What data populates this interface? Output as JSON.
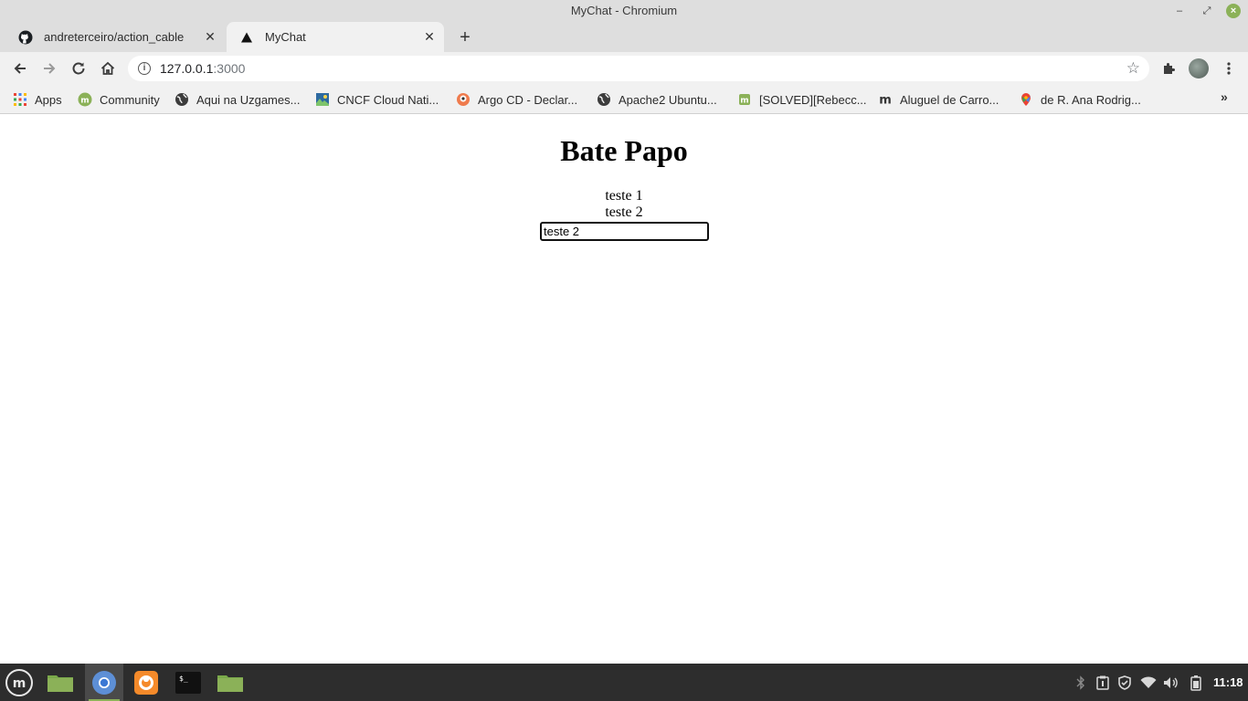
{
  "window": {
    "title": "MyChat - Chromium"
  },
  "tabs": [
    {
      "label": "andreterceiro/action_cable",
      "icon": "github-icon"
    },
    {
      "label": "MyChat",
      "icon": "triangle-icon"
    }
  ],
  "toolbar": {
    "url_host": "127.0.0.1",
    "url_port": ":3000"
  },
  "bookmarks": [
    {
      "label": "Apps",
      "icon": "apps-grid-icon"
    },
    {
      "label": "Community",
      "icon": "linux-mint-icon"
    },
    {
      "label": "Aqui na Uzgames...",
      "icon": "globe-icon"
    },
    {
      "label": "CNCF Cloud Nati...",
      "icon": "cncf-icon"
    },
    {
      "label": "Argo CD - Declar...",
      "icon": "argo-icon"
    },
    {
      "label": "Apache2 Ubuntu...",
      "icon": "globe-icon"
    },
    {
      "label": "[SOLVED][Rebecc...",
      "icon": "linux-mint-icon"
    },
    {
      "label": "Aluguel de Carro...",
      "icon": "m-icon"
    },
    {
      "label": "de R. Ana Rodrig...",
      "icon": "maps-pin-icon"
    }
  ],
  "page": {
    "title": "Bate Papo",
    "messages": [
      "teste 1",
      "teste 2"
    ],
    "input_value": "teste 2"
  },
  "taskbar": {
    "clock": "11:18"
  },
  "colors": {
    "mint_green": "#8bb158",
    "taskbar_bg": "#2d2d2d",
    "chrome_bg": "#dedede"
  }
}
